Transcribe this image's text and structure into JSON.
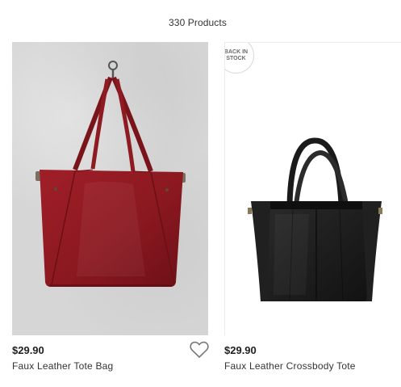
{
  "results": {
    "count_label": "330 Products"
  },
  "products": [
    {
      "price": "$29.90",
      "name": "Faux Leather Tote Bag",
      "image_subject": "red faux leather tote bag hanging on a wall hook",
      "color": "#8e1a22",
      "favorite_icon": "heart-outline-icon"
    },
    {
      "badge": "BACK IN STOCK",
      "price": "$29.90",
      "name": "Faux Leather Crossbody Tote",
      "image_subject": "black faux leather crossbody tote bag",
      "color": "#1c1c1c"
    }
  ],
  "colors": {
    "card_border": "#ececec",
    "text_primary": "#222222",
    "badge_text": "#6a6a6a"
  }
}
